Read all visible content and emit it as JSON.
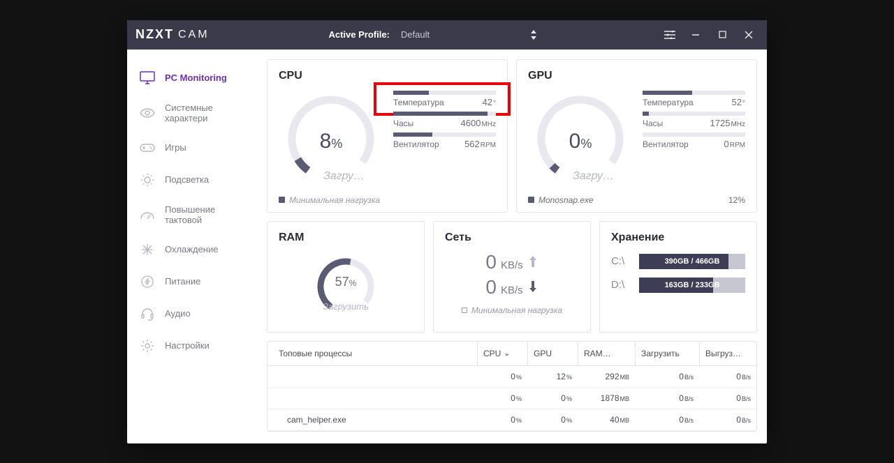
{
  "titlebar": {
    "brand": "NZXT",
    "brand_sub": "CAM",
    "profile_label": "Active Profile:",
    "profile_value": "Default"
  },
  "sidebar": {
    "items": [
      {
        "label": "PC Monitoring"
      },
      {
        "label": "Системные характери"
      },
      {
        "label": "Игры"
      },
      {
        "label": "Подсветка"
      },
      {
        "label": "Повышение тактовой"
      },
      {
        "label": "Охлаждение"
      },
      {
        "label": "Питание"
      },
      {
        "label": "Аудио"
      },
      {
        "label": "Настройки"
      }
    ]
  },
  "cpu": {
    "title": "CPU",
    "percent": "8",
    "percent_unit": "%",
    "sub": "Загру…",
    "bars": {
      "temp_label": "Температура",
      "temp_val": "42",
      "temp_unit": "°",
      "temp_fill": 35,
      "clock_label": "Часы",
      "clock_val": "4600",
      "clock_unit": "MHz",
      "clock_fill": 92,
      "fan_label": "Вентилятор",
      "fan_val": "562",
      "fan_unit": "RPM",
      "fan_fill": 38
    },
    "footer": "Минимальная нагрузка"
  },
  "gpu": {
    "title": "GPU",
    "percent": "0",
    "percent_unit": "%",
    "sub": "Загру…",
    "bars": {
      "temp_label": "Температура",
      "temp_val": "52",
      "temp_unit": "°",
      "temp_fill": 48,
      "clock_label": "Часы",
      "clock_val": "1725",
      "clock_unit": "MHz",
      "clock_fill": 6,
      "fan_label": "Вентилятор",
      "fan_val": "0",
      "fan_unit": "RPM",
      "fan_fill": 0
    },
    "footer_left": "Monosnap.exe",
    "footer_right": "12",
    "footer_right_unit": "%"
  },
  "ram": {
    "title": "RAM",
    "percent": "57",
    "unit": "%",
    "sub": "Загрузить"
  },
  "net": {
    "title": "Сеть",
    "up_val": "0",
    "up_unit": "KB/s",
    "down_val": "0",
    "down_unit": "KB/s",
    "footer": "Минимальная нагрузка"
  },
  "storage": {
    "title": "Хранение",
    "drives": [
      {
        "label": "C:\\",
        "text": "390GB / 466GB",
        "fill": 84
      },
      {
        "label": "D:\\",
        "text": "163GB / 233GB",
        "fill": 70
      }
    ]
  },
  "processes": {
    "header": {
      "name": "Топовые процессы",
      "cpu": "CPU",
      "gpu": "GPU",
      "ram": "RAM…",
      "dl": "Загрузить",
      "ul": "Выгруз…"
    },
    "rows": [
      {
        "name": "",
        "cpu": "0",
        "cpu_u": "%",
        "gpu": "12",
        "gpu_u": "%",
        "ram": "292",
        "ram_u": "MB",
        "dl": "0",
        "dl_u": "B/s",
        "ul": "0",
        "ul_u": "B/s"
      },
      {
        "name": "",
        "cpu": "0",
        "cpu_u": "%",
        "gpu": "0",
        "gpu_u": "%",
        "ram": "1878",
        "ram_u": "MB",
        "dl": "0",
        "dl_u": "B/s",
        "ul": "0",
        "ul_u": "B/s"
      },
      {
        "name": "cam_helper.exe",
        "cpu": "0",
        "cpu_u": "%",
        "gpu": "0",
        "gpu_u": "%",
        "ram": "40",
        "ram_u": "MB",
        "dl": "0",
        "dl_u": "B/s",
        "ul": "0",
        "ul_u": "B/s"
      }
    ]
  }
}
